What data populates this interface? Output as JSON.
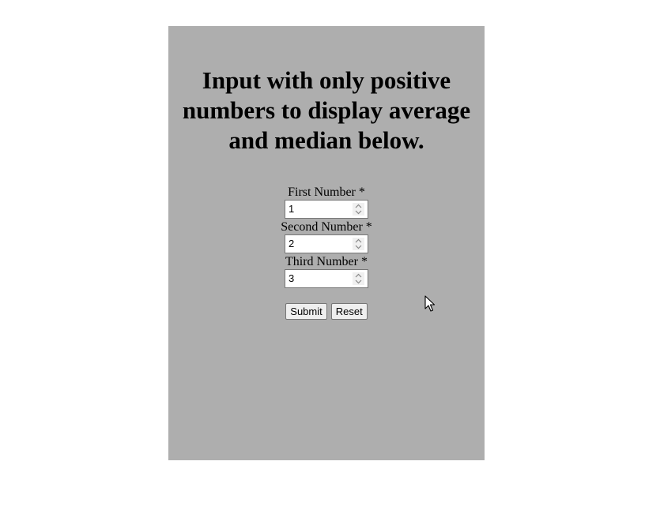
{
  "form": {
    "heading": "Input with only positive numbers to display average and median below.",
    "fields": [
      {
        "label": "First Number *",
        "value": "1"
      },
      {
        "label": "Second Number *",
        "value": "2"
      },
      {
        "label": "Third Number *",
        "value": "3"
      }
    ],
    "submit_label": "Submit",
    "reset_label": "Reset"
  },
  "colors": {
    "panel_background": "#aeaeae",
    "page_background": "#ffffff"
  }
}
